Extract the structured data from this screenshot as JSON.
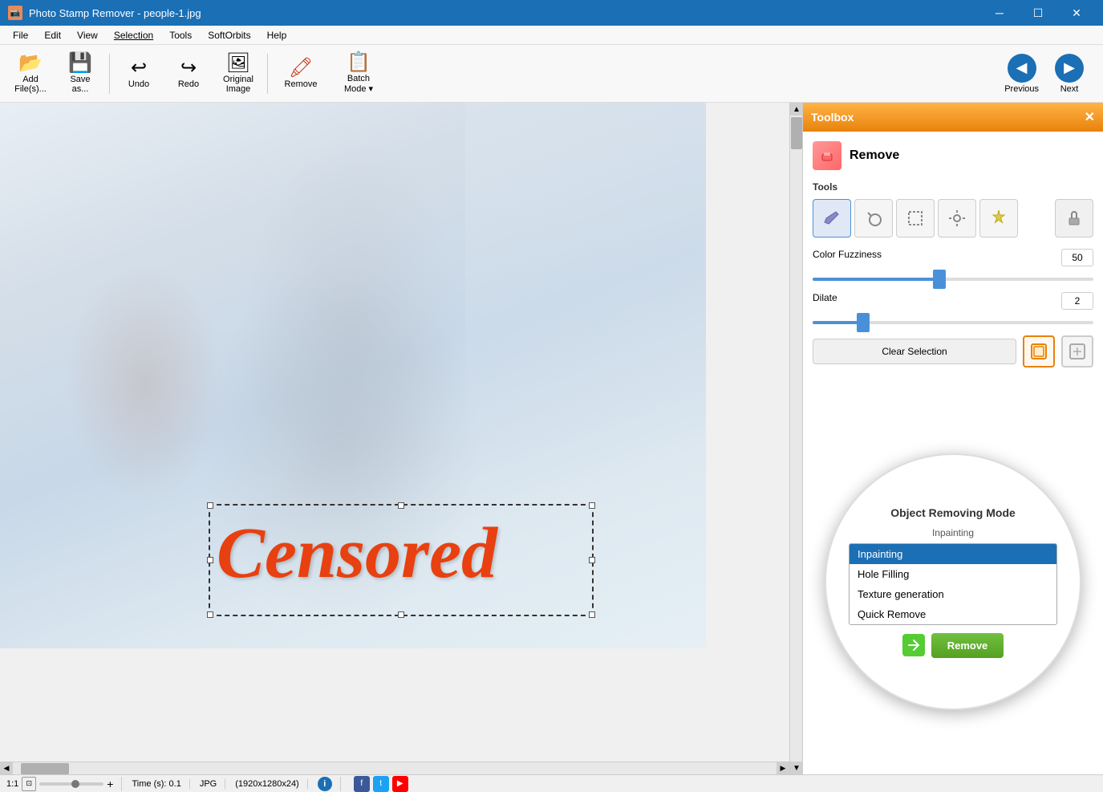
{
  "titleBar": {
    "appName": "Photo Stamp Remover",
    "fileName": "people-1.jpg",
    "fullTitle": "Photo Stamp Remover - people-1.jpg"
  },
  "menu": {
    "items": [
      "File",
      "Edit",
      "View",
      "Selection",
      "Tools",
      "SoftOrbits",
      "Help"
    ]
  },
  "toolbar": {
    "addFiles": "Add\nFile(s)...",
    "saveAs": "Save\nas...",
    "undo": "Undo",
    "redo": "Redo",
    "originalImage": "Original\nImage",
    "remove": "Remove",
    "batchMode": "Batch\nMode",
    "previous": "Previous",
    "next": "Next"
  },
  "toolbox": {
    "title": "Toolbox",
    "removeTitle": "Remove",
    "tools": {
      "label": "Tools",
      "buttons": [
        "✏️",
        "🔄",
        "⬜",
        "⚙️",
        "✨",
        "🖊️"
      ]
    },
    "colorFuzziness": {
      "label": "Color Fuzziness",
      "value": 50,
      "min": 0,
      "max": 100,
      "thumbPercent": 45
    },
    "dilate": {
      "label": "Dilate",
      "value": 2,
      "min": 0,
      "max": 10,
      "thumbPercent": 18
    },
    "clearSelectionLabel": "Clear Selection",
    "objectRemovingMode": {
      "title": "Object Removing Mode",
      "currentLabel": "Inpainting",
      "options": [
        "Inpainting",
        "Hole Filling",
        "Texture generation",
        "Quick Remove"
      ]
    },
    "removeButton": "Remove"
  },
  "statusBar": {
    "zoom": "1:1",
    "time": "Time (s): 0.1",
    "format": "JPG",
    "dimensions": "(1920x1280x24)"
  },
  "censored": {
    "text": "Censored"
  }
}
